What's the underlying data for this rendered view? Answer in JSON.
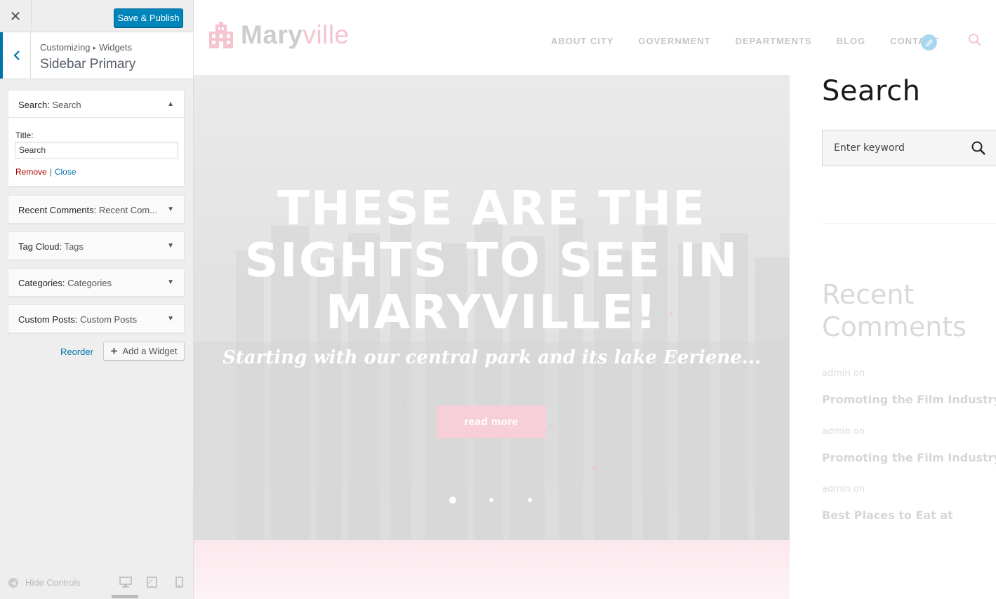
{
  "customizer": {
    "close_glyph": "✕",
    "save_label": "Save & Publish",
    "breadcrumb": [
      "Customizing",
      "▸",
      "Widgets"
    ],
    "panel_title": "Sidebar Primary",
    "widgets": [
      {
        "name": "Search:",
        "sub": "Search",
        "open": true
      },
      {
        "name": "Recent Comments:",
        "sub": "Recent Com..."
      },
      {
        "name": "Tag Cloud:",
        "sub": "Tags"
      },
      {
        "name": "Categories:",
        "sub": "Categories"
      },
      {
        "name": "Custom Posts:",
        "sub": "Custom Posts"
      }
    ],
    "search_widget": {
      "title_label": "Title:",
      "title_value": "Search",
      "remove_label": "Remove",
      "separator": "|",
      "close_label": "Close"
    },
    "reorder_label": "Reorder",
    "add_widget_label": "Add a Widget",
    "hide_controls_label": "Hide Controls"
  },
  "site": {
    "logo_part1": "Mary",
    "logo_part2": "ville",
    "nav": [
      "ABOUT CITY",
      "GOVERNMENT",
      "DEPARTMENTS",
      "BLOG",
      "CONTACT"
    ],
    "hero": {
      "title_lines": [
        "THESE ARE THE",
        "SIGHTS TO SEE IN",
        "MARYVILLE!"
      ],
      "subtitle": "Starting with our central park and its lake Eeriene...",
      "button": "read more"
    },
    "sidebar": {
      "search_title": "Search",
      "search_placeholder": "Enter keyword",
      "recent_comments_title": "Recent Comments",
      "comments": [
        {
          "meta": "admin on",
          "link": "Promoting the Film Industry"
        },
        {
          "meta": "admin on",
          "link": "Promoting the Film Industry"
        },
        {
          "meta": "admin on",
          "link": "Best Places to Eat at"
        }
      ]
    }
  },
  "colors": {
    "wp_blue": "#0085ba",
    "accent_pink": "#f5c4d0",
    "remove_red": "#a00"
  }
}
